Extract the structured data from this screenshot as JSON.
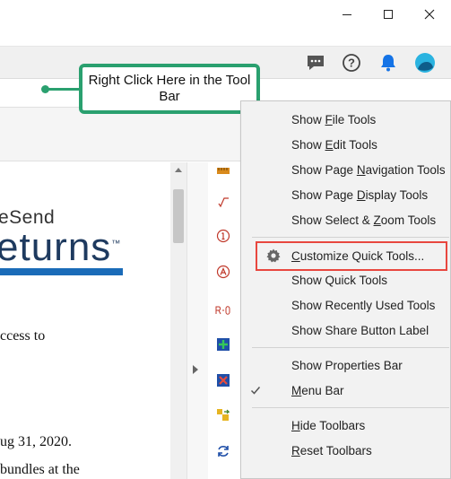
{
  "window": {
    "controls": {
      "minimize": "minimize",
      "maximize": "maximize",
      "close": "close"
    }
  },
  "toolbar_icons": [
    "comment-icon",
    "help-icon",
    "bell-icon",
    "avatar-icon"
  ],
  "callout": {
    "text": "Right Click Here in the Tool Bar"
  },
  "document": {
    "brand": "eSend",
    "title": "eturns",
    "lines": [
      "ccess to",
      "ug 31, 2020.",
      "bundles at the"
    ]
  },
  "context_menu": {
    "items": [
      {
        "label": "Show File Tools",
        "hotkey": "F"
      },
      {
        "label": "Show Edit Tools",
        "hotkey": "E"
      },
      {
        "label": "Show Page Navigation Tools",
        "hotkey": "N"
      },
      {
        "label": "Show Page Display Tools",
        "hotkey": "D"
      },
      {
        "label": "Show Select & Zoom Tools",
        "hotkey": "Z"
      },
      {
        "label": "Customize Quick Tools...",
        "hotkey": "C"
      },
      {
        "label": "Show Quick Tools",
        "hotkey": ""
      },
      {
        "label": "Show Recently Used Tools",
        "hotkey": ""
      },
      {
        "label": "Show Share Button Label",
        "hotkey": ""
      },
      {
        "label": "Show Properties Bar",
        "hotkey": ""
      },
      {
        "label": "Menu Bar",
        "hotkey": "M",
        "checked": true
      },
      {
        "label": "Hide Toolbars",
        "hotkey": "H"
      },
      {
        "label": "Reset Toolbars",
        "hotkey": "R"
      }
    ]
  },
  "colors": {
    "callout_border": "#2aa06f",
    "highlight_border": "#e8473f",
    "accent_blue": "#1a6bb8"
  }
}
